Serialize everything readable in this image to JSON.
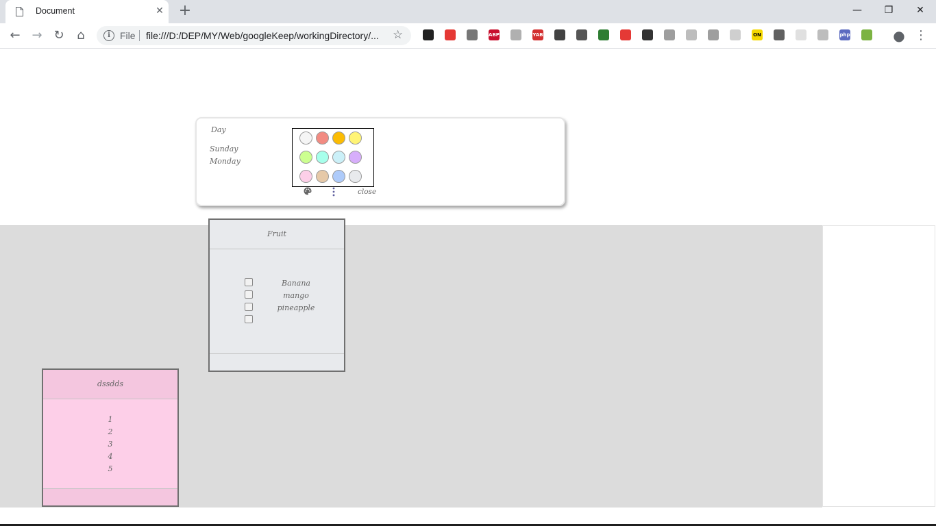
{
  "browser": {
    "tab_title": "Document",
    "tab_close": "✕",
    "new_tab": "+",
    "window_controls": {
      "minimize": "—",
      "restore": "❐",
      "close": "✕"
    },
    "nav": {
      "back": "←",
      "forward": "→",
      "reload": "↻",
      "home": "⌂"
    },
    "omnibox": {
      "info": "i",
      "scheme_label": "File",
      "url": "file:///D:/DEP/MY/Web/googleKeep/workingDirectory/...",
      "star": "☆"
    },
    "extensions": [
      {
        "name": "tampermonkey-icon",
        "color": "#222222"
      },
      {
        "name": "red-extension-icon",
        "color": "#e53935"
      },
      {
        "name": "globe-gear-icon",
        "color": "#777777"
      },
      {
        "name": "adblock-plus-icon",
        "color": "#c8102e",
        "label": "ABP"
      },
      {
        "name": "puzzle-icon",
        "color": "#b0b0b0"
      },
      {
        "name": "yab-icon",
        "color": "#d32f2f",
        "label": "YAB"
      },
      {
        "name": "download-circle-icon",
        "color": "#424242"
      },
      {
        "name": "image-extension-icon",
        "color": "#555555"
      },
      {
        "name": "green-download-icon",
        "color": "#2e7d32"
      },
      {
        "name": "opera-icon",
        "color": "#e53935"
      },
      {
        "name": "download-arrow-icon",
        "color": "#333333"
      },
      {
        "name": "photo-extension-icon",
        "color": "#9e9e9e"
      },
      {
        "name": "bag-icon",
        "color": "#bdbdbd"
      },
      {
        "name": "cube-icon",
        "color": "#9e9e9e"
      },
      {
        "name": "window-icon",
        "color": "#cfcfcf"
      },
      {
        "name": "on-icon",
        "color": "#f5d800",
        "label": "ON"
      },
      {
        "name": "gear-extension-icon",
        "color": "#616161"
      },
      {
        "name": "faded-circle-icon",
        "color": "#e0e0e0"
      },
      {
        "name": "php-light-icon",
        "color": "#bdbdbd"
      },
      {
        "name": "php-icon",
        "color": "#5c6bc0",
        "label": "php"
      },
      {
        "name": "android-circle-icon",
        "color": "#7cb342"
      }
    ],
    "profile": "●",
    "menu": "⋮"
  },
  "editor": {
    "title": "Day",
    "body_lines": [
      "Sunday",
      "Monday"
    ],
    "palette_colors": [
      "#f5f5f5",
      "#f28b82",
      "#fbbc04",
      "#fff475",
      "#ccff90",
      "#a7ffeb",
      "#cbf0f8",
      "#d7aefb",
      "#fdcfe8",
      "#e6c9a8",
      "#aecbfa",
      "#e8eaed"
    ],
    "close_label": "close"
  },
  "notes": [
    {
      "title": "Fruit",
      "color": "#e8eaed",
      "items": [
        "Banana",
        "mango",
        "pineapple"
      ],
      "checkbox_count": 4
    },
    {
      "title": "dssdds",
      "color": "#fdcfe8",
      "lines": [
        "1",
        "2",
        "3",
        "4",
        "5"
      ]
    }
  ]
}
